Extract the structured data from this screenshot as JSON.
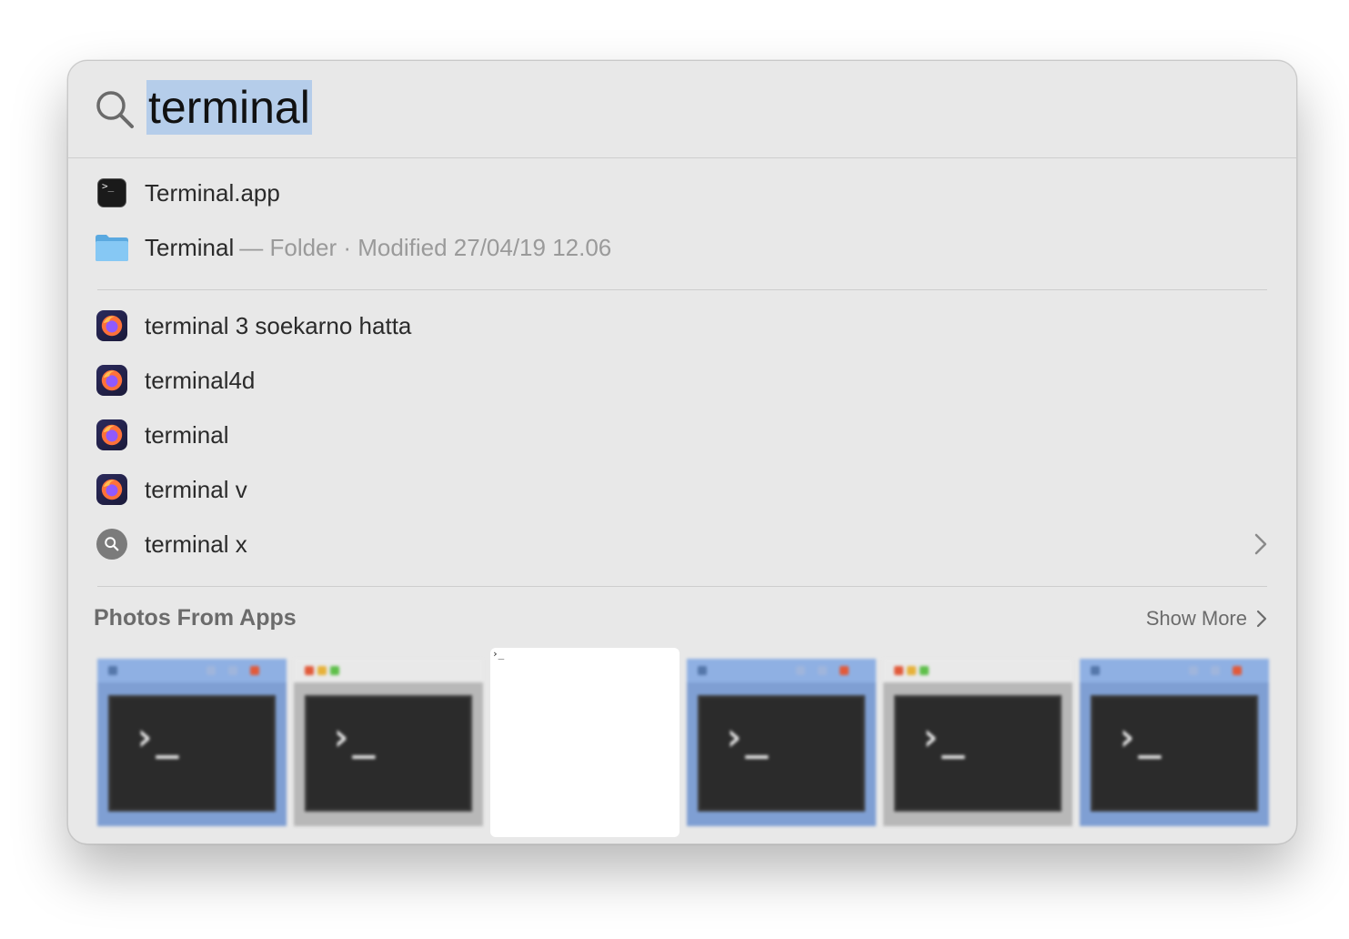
{
  "search": {
    "query": "terminal"
  },
  "results": [
    {
      "label": "Terminal.app",
      "sub": "",
      "icon": "terminal-app-icon"
    },
    {
      "label": "Terminal",
      "sub": "— Folder · Modified 27/04/19 12.06",
      "icon": "folder-icon"
    },
    {
      "label": "terminal 3 soekarno hatta",
      "icon": "firefox-icon"
    },
    {
      "label": "terminal4d",
      "icon": "firefox-icon"
    },
    {
      "label": "terminal",
      "icon": "firefox-icon"
    },
    {
      "label": "terminal v",
      "icon": "firefox-icon"
    },
    {
      "label": "terminal x",
      "icon": "search-suggestion-icon"
    }
  ],
  "photos": {
    "title": "Photos From Apps",
    "show_more": "Show More",
    "thumb_prompt": "›_"
  },
  "colors": {
    "panel_bg": "#e8e8e8",
    "selection": "#b5cdea",
    "folder_blue": "#79c0f0"
  }
}
